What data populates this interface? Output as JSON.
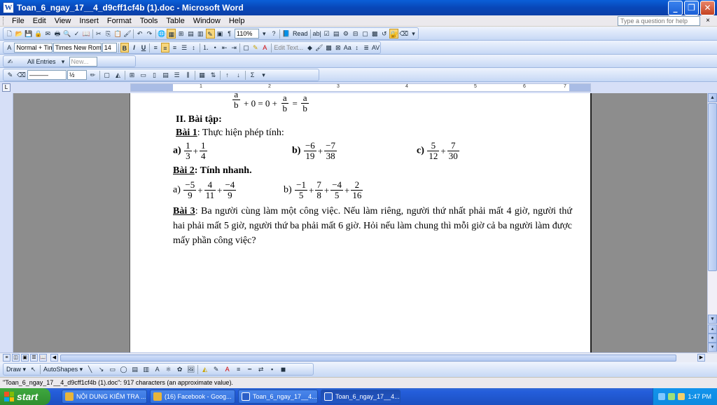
{
  "window": {
    "title": "Toan_6_ngay_17__4_d9cff1cf4b (1).doc - Microsoft Word",
    "min_icon": "minimize-icon",
    "max_icon": "maximize-icon",
    "close_icon": "close-icon",
    "app_icon_letter": "W"
  },
  "menu": {
    "items": [
      "File",
      "Edit",
      "View",
      "Insert",
      "Format",
      "Tools",
      "Table",
      "Window",
      "Help"
    ],
    "help_placeholder": "Type a question for help",
    "doc_close": "×"
  },
  "toolbar": {
    "zoom": "110%",
    "read_label": "Read",
    "style": "Normal + Times",
    "font": "Times New Roman",
    "size": "14",
    "bold": "B",
    "italic": "I",
    "underline": "U",
    "edit_text": "Edit Text...",
    "all_entries": "All Entries",
    "new_label": "New...",
    "line_weight": "½",
    "sigma": "Σ"
  },
  "ruler": {
    "numbers": [
      "1",
      "2",
      "3",
      "4",
      "5",
      "6",
      "7"
    ],
    "corner": "L"
  },
  "document": {
    "line0": {
      "a": "a",
      "b": "b",
      "plus0": "+ 0 = 0 +",
      "eq": "="
    },
    "heading": "II. Bài tập:",
    "bai1_label": "Bài 1",
    "bai1_text": ": Thực hiện phép tính:",
    "bai1_items": [
      {
        "label": "a)",
        "n1": "1",
        "d1": "3",
        "op": "+",
        "n2": "1",
        "d2": "4"
      },
      {
        "label": "b)",
        "n1": "−6",
        "d1": "19",
        "op": "+",
        "n2": "−7",
        "d2": "38"
      },
      {
        "label": "c)",
        "n1": "5",
        "d1": "12",
        "op": "+",
        "n2": "7",
        "d2": "30"
      }
    ],
    "bai2_label": "Bài 2",
    "bai2_text": ": Tính nhanh.",
    "bai2_a": {
      "label": "a)",
      "fracs": [
        [
          "−5",
          "9"
        ],
        [
          "4",
          "11"
        ],
        [
          "−4",
          "9"
        ]
      ],
      "op": "+"
    },
    "bai2_b": {
      "label": "b)",
      "fracs": [
        [
          "−1",
          "5"
        ],
        [
          "7",
          "8"
        ],
        [
          "−4",
          "5"
        ],
        [
          "2",
          "16"
        ]
      ],
      "op": "+"
    },
    "bai3_label": "Bài 3",
    "bai3_text": ": Ba người cùng làm  một công việc. Nếu làm riêng, người thứ nhất phải mất 4 giờ, người thứ hai phải mất 5 giờ, người thứ ba phải mất 6 giờ. Hỏi nếu làm chung thì mỗi giờ cả ba người làm được mấy phần công việc?"
  },
  "drawbar": {
    "draw": "Draw ▾",
    "autoshapes": "AutoShapes ▾"
  },
  "status": "\"Toan_6_ngay_17__4_d9cff1cf4b (1).doc\": 917 characters (an approximate value).",
  "taskbar": {
    "start": "start",
    "tasks": [
      {
        "label": "NỘI DUNG KIỂM TRA ...",
        "color": "#e8b53a"
      },
      {
        "label": "(16) Facebook - Goog...",
        "color": "#e8b53a"
      },
      {
        "label": "Toan_6_ngay_17__4...",
        "color": "#2b5fc8"
      },
      {
        "label": "Toan_6_ngay_17__4...",
        "color": "#2b5fc8"
      }
    ],
    "clock": "1:47 PM"
  }
}
